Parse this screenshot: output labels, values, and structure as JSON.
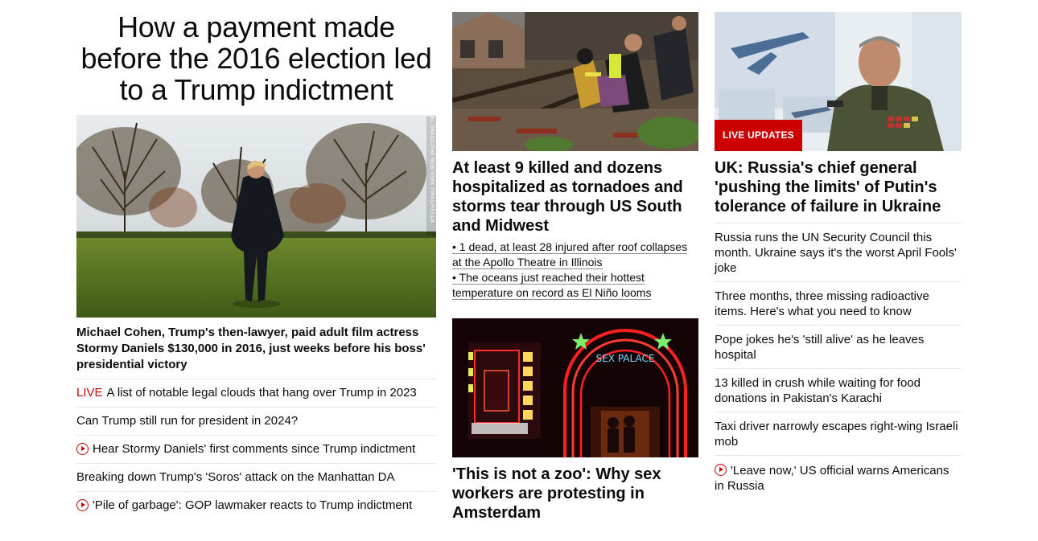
{
  "left": {
    "headline": "How a payment made before the 2016 election led to a Trump indictment",
    "photo_credit": "AL DRAGO/THE NEW YORK TIMES/REDUX",
    "lead_caption": "Michael Cohen, Trump's then-lawyer, paid adult film actress Stormy Daniels $130,000 in 2016, just weeks before his boss' presidential victory",
    "links": [
      {
        "live": "LIVE",
        "text": "A list of notable legal clouds that hang over Trump in 2023"
      },
      {
        "text": "Can Trump still run for president in 2024?"
      },
      {
        "video": true,
        "text": "Hear Stormy Daniels' first comments since Trump indictment"
      },
      {
        "text": "Breaking down Trump's 'Soros' attack on the Manhattan DA"
      },
      {
        "video": true,
        "text": "'Pile of garbage': GOP lawmaker reacts to Trump indictment"
      }
    ]
  },
  "middle": {
    "story1": {
      "title": "At least 9 killed and dozens hospitalized as tornadoes and storms tear through US South and Midwest",
      "bullets": [
        "• 1 dead, at least 28 injured after roof collapses at the Apollo Theatre in Illinois",
        "• The oceans just reached their hottest temperature on record as El Niño looms"
      ]
    },
    "story2": {
      "sign_text": "SEX PALACE",
      "title": "'This is not a zoo': Why sex workers are protesting in Amsterdam"
    }
  },
  "right": {
    "badge": "LIVE UPDATES",
    "title": "UK: Russia's chief general 'pushing the limits' of Putin's tolerance of failure in Ukraine",
    "links": [
      {
        "text": "Russia runs the UN Security Council this month. Ukraine says it's the worst April Fools' joke"
      },
      {
        "text": "Three months, three missing radioactive items. Here's what you need to know"
      },
      {
        "text": "Pope jokes he's 'still alive' as he leaves hospital"
      },
      {
        "text": "13 killed in crush while waiting for food donations in Pakistan's Karachi"
      },
      {
        "text": "Taxi driver narrowly escapes right-wing Israeli mob"
      },
      {
        "video": true,
        "text": "'Leave now,' US official warns Americans in Russia"
      }
    ]
  },
  "colors": {
    "live_red": "#cc0000",
    "divider": "#e6e6e6",
    "text": "#0c0c0c"
  }
}
